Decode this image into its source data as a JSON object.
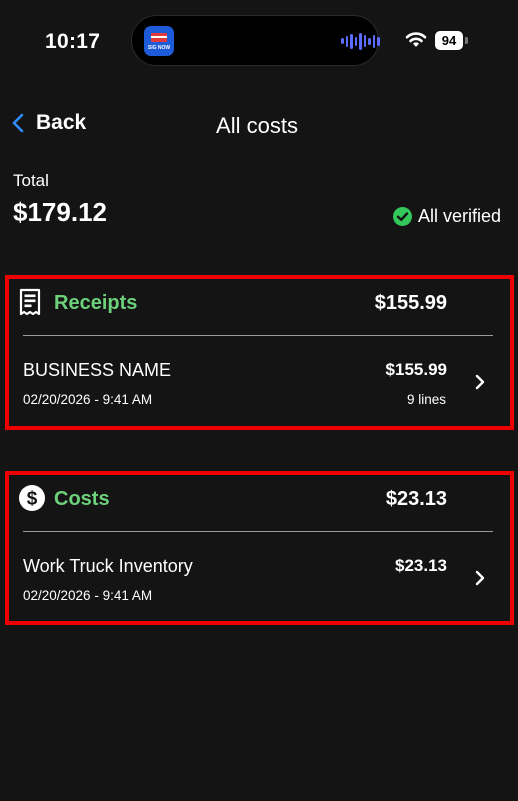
{
  "status_bar": {
    "time": "10:17",
    "battery": "94",
    "island_app_text": "SIG NOW"
  },
  "nav": {
    "back_label": "Back",
    "title": "All costs"
  },
  "summary": {
    "total_label": "Total",
    "total_value": "$179.12",
    "verified_label": "All verified"
  },
  "sections": {
    "receipts": {
      "title": "Receipts",
      "amount": "$155.99",
      "item": {
        "name": "BUSINESS NAME",
        "date": "02/20/2026 - 9:41 AM",
        "amount": "$155.99",
        "lines": "9 lines"
      }
    },
    "costs": {
      "title": "Costs",
      "amount": "$23.13",
      "item": {
        "name": "Work Truck Inventory",
        "date": "02/20/2026 - 9:41 AM",
        "amount": "$23.13"
      }
    }
  },
  "colors": {
    "background": "#141414",
    "accent_green": "#6dd07a",
    "verified_green": "#34c759",
    "back_blue": "#2f8cff",
    "highlight_red": "#ee0000"
  },
  "icons": [
    "wifi-icon",
    "back-chevron-icon",
    "check-circle-icon",
    "receipt-icon",
    "dollar-circle-icon",
    "chevron-right-icon"
  ]
}
